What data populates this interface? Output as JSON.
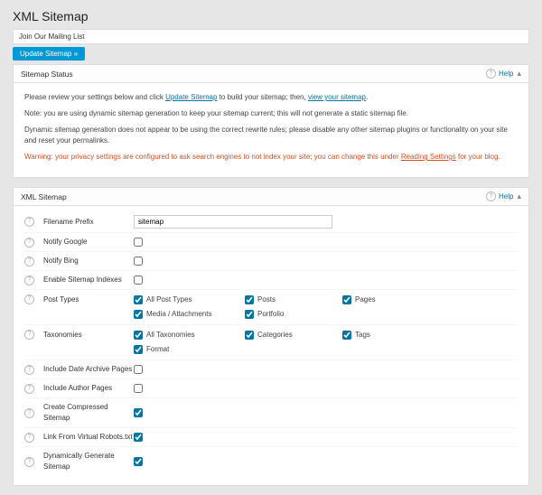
{
  "page": {
    "title": "XML Sitemap"
  },
  "mailing": {
    "text": "Join Our Mailing List"
  },
  "update_btn": "Update Sitemap »",
  "status": {
    "title": "Sitemap Status",
    "help": "Help",
    "p1a": "Please review your settings below and click ",
    "p1link1": "Update Sitemap",
    "p1b": " to build your sitemap; then, ",
    "p1link2": "view your sitemap",
    "p1c": ".",
    "p2": "Note: you are using dynamic sitemap generation to keep your sitemap current; this will not generate a static sitemap file.",
    "p3": "Dynamic sitemap generation does not appear to be using the correct rewrite rules; please disable any other sitemap plugins or functionality on your site and reset your permalinks.",
    "warn_a": "Warning: your privacy settings are configured to ask search engines to not index your site; you can change this under ",
    "warn_link": "Reading Settings",
    "warn_b": " for your blog."
  },
  "form": {
    "title": "XML Sitemap",
    "help": "Help",
    "rows": {
      "filename_prefix": {
        "label": "Filename Prefix",
        "value": "sitemap"
      },
      "notify_google": {
        "label": "Notify Google",
        "checked": false
      },
      "notify_bing": {
        "label": "Notify Bing",
        "checked": false
      },
      "enable_indexes": {
        "label": "Enable Sitemap Indexes",
        "checked": false
      },
      "post_types": {
        "label": "Post Types",
        "items": [
          {
            "label": "All Post Types",
            "checked": true
          },
          {
            "label": "Posts",
            "checked": true
          },
          {
            "label": "Pages",
            "checked": true
          },
          {
            "label": "Media / Attachments",
            "checked": true
          },
          {
            "label": "Portfolio",
            "checked": true
          }
        ]
      },
      "taxonomies": {
        "label": "Taxonomies",
        "items": [
          {
            "label": "All Taxonomies",
            "checked": true
          },
          {
            "label": "Categories",
            "checked": true
          },
          {
            "label": "Tags",
            "checked": true
          },
          {
            "label": "Format",
            "checked": true
          }
        ]
      },
      "include_date": {
        "label": "Include Date Archive Pages",
        "checked": false
      },
      "include_author": {
        "label": "Include Author Pages",
        "checked": false
      },
      "compressed": {
        "label": "Create Compressed Sitemap",
        "checked": true
      },
      "robots": {
        "label": "Link From Virtual Robots.txt",
        "checked": true
      },
      "dynamic": {
        "label": "Dynamically Generate Sitemap",
        "checked": true
      }
    }
  }
}
